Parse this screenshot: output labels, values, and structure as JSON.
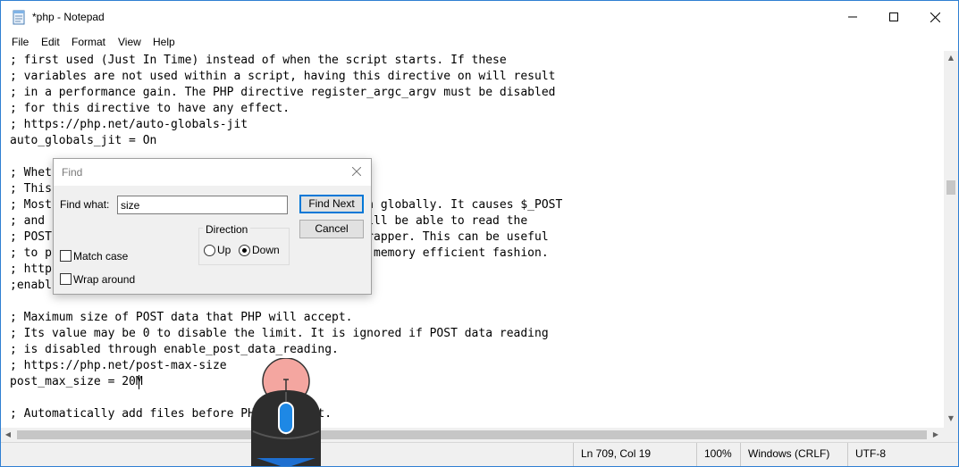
{
  "window": {
    "title": "*php - Notepad"
  },
  "menu": [
    "File",
    "Edit",
    "Format",
    "View",
    "Help"
  ],
  "editor": {
    "lines": [
      "; first used (Just In Time) instead of when the script starts. If these",
      "; variables are not used within a script, having this directive on will result",
      "; in a performance gain. The PHP directive register_argc_argv must be disabled",
      "; for this directive to have any effect.",
      "; https://php.net/auto-globals-jit",
      "auto_globals_jit = On",
      "",
      "; Whet",
      "; This",
      "; Most                                            on globally. It causes $_POST",
      "; and                                             will be able to read the",
      "; POST                                            wrapper. This can be useful",
      "; to p                                            a memory efficient fashion.",
      "; http",
      ";enabl",
      "",
      "; Maximum size of POST data that PHP will accept.",
      "; Its value may be 0 to disable the limit. It is ignored if POST data reading",
      "; is disabled through enable_post_data_reading.",
      "; https://php.net/post-max-size",
      "post_max_size = 20M",
      "",
      "; Automatically add files before PHP document."
    ]
  },
  "find_dialog": {
    "title": "Find",
    "find_what_label": "Find what:",
    "find_what_value": "size",
    "find_next_label": "Find Next",
    "cancel_label": "Cancel",
    "direction_label": "Direction",
    "up_label": "Up",
    "down_label": "Down",
    "direction_selected": "Down",
    "match_case_label": "Match case",
    "match_case_checked": false,
    "wrap_around_label": "Wrap around",
    "wrap_around_checked": false
  },
  "status": {
    "position": "Ln 709, Col 19",
    "zoom": "100%",
    "line_ending": "Windows (CRLF)",
    "encoding": "UTF-8"
  },
  "icons": {
    "app": "notepad-icon",
    "minimize": "minimize-icon",
    "maximize": "maximize-icon",
    "close": "close-icon",
    "overlay": "mouse-scroll-icon"
  },
  "colors": {
    "window_border": "#2f7fd2",
    "accent": "#0078d7",
    "mouse_wheel": "#1e88e5",
    "mouse_highlight": "#f4a6a0",
    "mouse_body": "#2d2d2d"
  }
}
